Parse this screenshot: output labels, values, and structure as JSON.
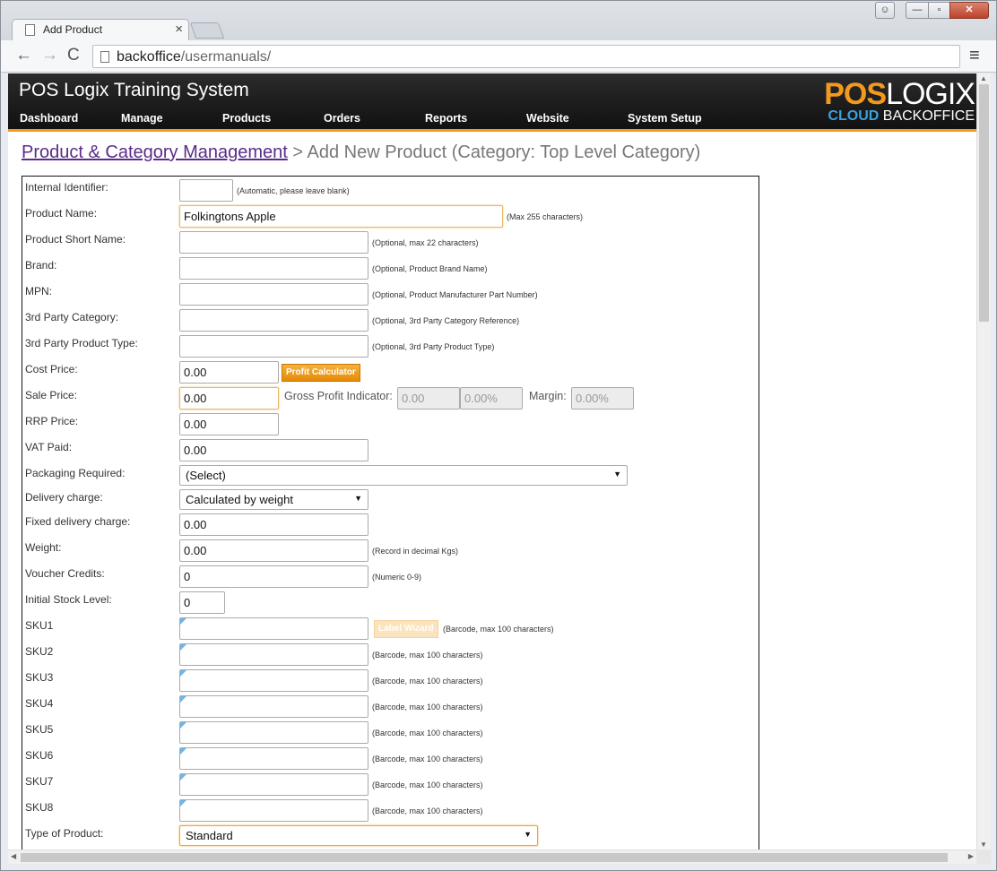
{
  "browser": {
    "tab_title": "Add Product",
    "tab_close": "×",
    "url_host": "backoffice",
    "url_path": "/usermanuals/",
    "back": "←",
    "forward": "→",
    "reload": "C",
    "menu": "≡",
    "win_min": "—",
    "win_max": "▫",
    "win_close": "✕"
  },
  "app": {
    "title": "POS Logix Training System",
    "nav": [
      "Dashboard",
      "Manage",
      "Products",
      "Orders",
      "Reports",
      "Website",
      "System Setup"
    ],
    "logo_pos": "POS",
    "logo_logix": "LOGIX",
    "logo_cloud": "CLOUD",
    "logo_backoffice": "BACKOFFICE"
  },
  "breadcrumb": {
    "link": "Product & Category Management",
    "rest": "> Add New Product (Category: Top Level Category)"
  },
  "form": {
    "internal_identifier": {
      "label": "Internal Identifier:",
      "value": "",
      "hint": "(Automatic, please leave blank)"
    },
    "product_name": {
      "label": "Product Name:",
      "value": "Folkingtons Apple",
      "hint": "(Max 255 characters)"
    },
    "short_name": {
      "label": "Product Short Name:",
      "value": "",
      "hint": "(Optional, max 22 characters)"
    },
    "brand": {
      "label": "Brand:",
      "value": "",
      "hint": "(Optional, Product Brand Name)"
    },
    "mpn": {
      "label": "MPN:",
      "value": "",
      "hint": "(Optional, Product Manufacturer Part Number)"
    },
    "third_party_category": {
      "label": "3rd Party Category:",
      "value": "",
      "hint": "(Optional, 3rd Party Category Reference)"
    },
    "third_party_type": {
      "label": "3rd Party Product Type:",
      "value": "",
      "hint": "(Optional, 3rd Party Product Type)"
    },
    "cost_price": {
      "label": "Cost Price:",
      "value": "0.00",
      "button": "Profit Calculator"
    },
    "sale_price": {
      "label": "Sale Price:",
      "value": "0.00",
      "gp_label": "Gross Profit Indicator:",
      "gp_value": "0.00",
      "gp_percent": "0.00%",
      "margin_label": "Margin:",
      "margin_value": "0.00%"
    },
    "rrp_price": {
      "label": "RRP Price:",
      "value": "0.00"
    },
    "vat_paid": {
      "label": "VAT Paid:",
      "value": "0.00"
    },
    "packaging": {
      "label": "Packaging Required:",
      "value": "(Select)"
    },
    "delivery_charge": {
      "label": "Delivery charge:",
      "value": "Calculated by weight"
    },
    "fixed_delivery": {
      "label": "Fixed delivery charge:",
      "value": "0.00"
    },
    "weight": {
      "label": "Weight:",
      "value": "0.00",
      "hint": "(Record in decimal Kgs)"
    },
    "voucher_credits": {
      "label": "Voucher Credits:",
      "value": "0",
      "hint": "(Numeric 0-9)"
    },
    "initial_stock": {
      "label": "Initial Stock Level:",
      "value": "0"
    },
    "label_wizard": "Label Wizard",
    "sku_hint": "(Barcode, max 100 characters)",
    "skus": [
      {
        "label": "SKU1",
        "value": ""
      },
      {
        "label": "SKU2",
        "value": ""
      },
      {
        "label": "SKU3",
        "value": ""
      },
      {
        "label": "SKU4",
        "value": ""
      },
      {
        "label": "SKU5",
        "value": ""
      },
      {
        "label": "SKU6",
        "value": ""
      },
      {
        "label": "SKU7",
        "value": ""
      },
      {
        "label": "SKU8",
        "value": ""
      }
    ],
    "type_of_product": {
      "label": "Type of Product:",
      "value": "Standard"
    }
  },
  "colors": {
    "accent": "#f39a1e",
    "cloud_blue": "#3aa1e0",
    "link": "#5a2b8a"
  }
}
